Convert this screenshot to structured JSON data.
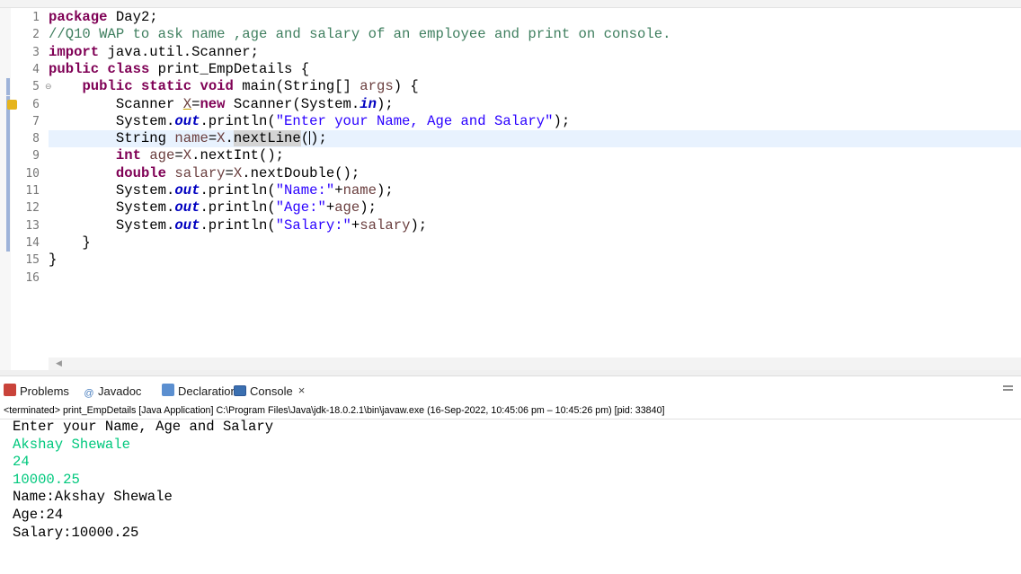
{
  "editor": {
    "lines": [
      {
        "n": "1",
        "html": "<span class=\"kw\">package</span> Day2;"
      },
      {
        "n": "2",
        "html": "<span class=\"cm\">//Q10 WAP to ask name ,age and salary of an employee and print on console.</span>"
      },
      {
        "n": "3",
        "html": "<span class=\"kw\">import</span> java.util.Scanner;"
      },
      {
        "n": "4",
        "html": "<span class=\"kw\">public</span> <span class=\"kw\">class</span> print_EmpDetails {"
      },
      {
        "n": "5",
        "html": "    <span class=\"kw\">public</span> <span class=\"kw\">static</span> <span class=\"kw\">void</span> main(String[] <span class=\"var\">args</span>) {"
      },
      {
        "n": "6",
        "html": "        Scanner <span class=\"var underline\">X</span>=<span class=\"kw\">new</span> Scanner(System.<span class=\"fld\">in</span>);"
      },
      {
        "n": "7",
        "html": "        System.<span class=\"fld\">out</span>.println(<span class=\"st\">\"Enter your Name, Age and Salary\"</span>);"
      },
      {
        "n": "8",
        "html": "        String <span class=\"var\">name</span>=<span class=\"var\">X</span>.<span class=\"occ\">nextLine</span>(<span class=\"caret\"></span>);"
      },
      {
        "n": "9",
        "html": "        <span class=\"kw\">int</span> <span class=\"var\">age</span>=<span class=\"var\">X</span>.nextInt();"
      },
      {
        "n": "10",
        "html": "        <span class=\"kw\">double</span> <span class=\"var\">salary</span>=<span class=\"var\">X</span>.nextDouble();"
      },
      {
        "n": "11",
        "html": "        System.<span class=\"fld\">out</span>.println(<span class=\"st\">\"Name:\"</span>+<span class=\"var\">name</span>);"
      },
      {
        "n": "12",
        "html": "        System.<span class=\"fld\">out</span>.println(<span class=\"st\">\"Age:\"</span>+<span class=\"var\">age</span>);"
      },
      {
        "n": "13",
        "html": "        System.<span class=\"fld\">out</span>.println(<span class=\"st\">\"Salary:\"</span>+<span class=\"var\">salary</span>);"
      },
      {
        "n": "14",
        "html": "    }"
      },
      {
        "n": "15",
        "html": "}"
      },
      {
        "n": "16",
        "html": ""
      }
    ],
    "current_line": "8",
    "fold_marker": "⊖"
  },
  "tabs": [
    {
      "label": "Problems",
      "icon": "problems-icon",
      "color": "#c9433a"
    },
    {
      "label": "Javadoc",
      "icon": "javadoc-icon",
      "color": "#4a7fbf"
    },
    {
      "label": "Declaration",
      "icon": "declaration-icon",
      "color": "#5b8fd0"
    },
    {
      "label": "Console",
      "icon": "console-icon",
      "color": "#3a6fb0",
      "close": "×"
    }
  ],
  "console": {
    "description": "<terminated> print_EmpDetails [Java Application] C:\\Program Files\\Java\\jdk-18.0.2.1\\bin\\javaw.exe  (16-Sep-2022, 10:45:06 pm – 10:45:26 pm) [pid: 33840]",
    "output": [
      {
        "text": "Enter your Name, Age and Salary",
        "type": "stdout"
      },
      {
        "text": "Akshay Shewale",
        "type": "stdin"
      },
      {
        "text": "24",
        "type": "stdin"
      },
      {
        "text": "10000.25",
        "type": "stdin"
      },
      {
        "text": "Name:Akshay Shewale",
        "type": "stdout"
      },
      {
        "text": "Age:24",
        "type": "stdout"
      },
      {
        "text": "Salary:10000.25",
        "type": "stdout"
      }
    ]
  },
  "colors": {
    "keyword": "#7f0055",
    "comment": "#3f7f5f",
    "string": "#2a00ff",
    "field": "#0000c0",
    "console_input": "#00c87d",
    "current_line_bg": "#e8f2fe"
  }
}
